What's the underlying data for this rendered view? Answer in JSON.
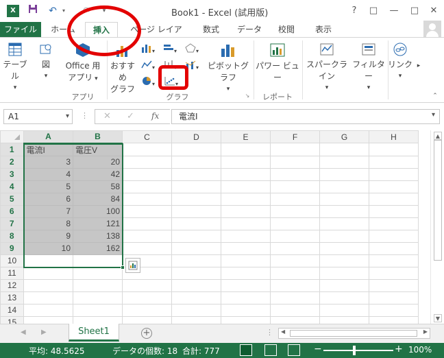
{
  "title_bar": {
    "app_icon_letter": "X",
    "quick_access": [
      "save-icon",
      "undo-icon",
      "customize-icon"
    ],
    "title": "Book1 - Excel (試用版)",
    "window_buttons": [
      "?",
      "□",
      "—",
      "□",
      "✕"
    ]
  },
  "tabs": [
    {
      "label": "ファイル"
    },
    {
      "label": "ホーム"
    },
    {
      "label": "挿入"
    },
    {
      "label": "ページ レイアウト"
    },
    {
      "label": "数式"
    },
    {
      "label": "データ"
    },
    {
      "label": "校閲"
    },
    {
      "label": "表示"
    }
  ],
  "ribbon": {
    "table": "テーブル",
    "illustrations": "図",
    "office_apps_line1": "Office 用",
    "office_apps_line2": "アプリ",
    "recommended_chart_line1": "おすすめ",
    "recommended_chart_line2": "グラフ",
    "pivot_chart": "ピボットグラフ",
    "power_view": "パワー ビュー",
    "sparkline": "スパークライン",
    "filter": "フィルター",
    "link": "リンク",
    "group_apps": "アプリ",
    "group_charts": "グラフ",
    "group_reports": "レポート"
  },
  "formula_bar": {
    "name_box": "A1",
    "fx_label": "fx",
    "formula": "電流I"
  },
  "columns": [
    "A",
    "B",
    "C",
    "D",
    "E",
    "F",
    "G",
    "H"
  ],
  "rows": [
    {
      "n": "1",
      "a": "電流I",
      "b": "電圧V"
    },
    {
      "n": "2",
      "a": "3",
      "b": "20"
    },
    {
      "n": "3",
      "a": "4",
      "b": "42"
    },
    {
      "n": "4",
      "a": "5",
      "b": "58"
    },
    {
      "n": "5",
      "a": "6",
      "b": "84"
    },
    {
      "n": "6",
      "a": "7",
      "b": "100"
    },
    {
      "n": "7",
      "a": "8",
      "b": "121"
    },
    {
      "n": "8",
      "a": "9",
      "b": "138"
    },
    {
      "n": "9",
      "a": "10",
      "b": "162"
    },
    {
      "n": "10",
      "a": "",
      "b": ""
    },
    {
      "n": "11",
      "a": "",
      "b": ""
    },
    {
      "n": "12",
      "a": "",
      "b": ""
    },
    {
      "n": "13",
      "a": "",
      "b": ""
    },
    {
      "n": "14",
      "a": "",
      "b": ""
    },
    {
      "n": "15",
      "a": "",
      "b": ""
    }
  ],
  "sheet_tab": "Sheet1",
  "status": {
    "average": "平均: 48.5625",
    "count": "データの個数: 18",
    "sum": "合計: 777",
    "zoom": "100%"
  },
  "colors": {
    "excel_green": "#217346",
    "annotation_red": "#e30000"
  }
}
